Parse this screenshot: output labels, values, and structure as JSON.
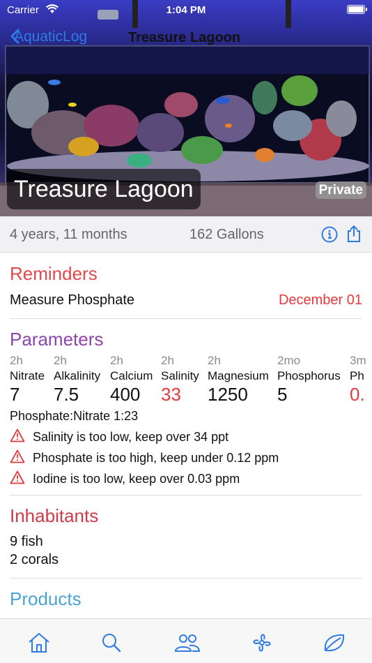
{
  "status": {
    "carrier": "Carrier",
    "time": "1:04 PM"
  },
  "nav": {
    "back_label": "AquaticLog",
    "title": "Treasure Lagoon"
  },
  "hero": {
    "tank_name": "Treasure Lagoon",
    "privacy_badge": "Private"
  },
  "info": {
    "age": "4 years, 11 months",
    "volume": "162 Gallons"
  },
  "reminders": {
    "title": "Reminders",
    "items": [
      {
        "label": "Measure Phosphate",
        "date": "December 01"
      }
    ]
  },
  "parameters": {
    "title": "Parameters",
    "items": [
      {
        "ago": "2h",
        "name": "Nitrate",
        "value": "7"
      },
      {
        "ago": "2h",
        "name": "Alkalinity",
        "value": "7.5"
      },
      {
        "ago": "2h",
        "name": "Calcium",
        "value": "400"
      },
      {
        "ago": "2h",
        "name": "Salinity",
        "value": "33"
      },
      {
        "ago": "2h",
        "name": "Magnesium",
        "value": "1250"
      },
      {
        "ago": "2mo",
        "name": "Phosphorus",
        "value": "5"
      },
      {
        "ago": "3m",
        "name": "Ph",
        "value": "0."
      }
    ],
    "ratio": "Phosphate:Nitrate 1:23",
    "warnings": [
      "Salinity is too low, keep over 34 ppt",
      "Phosphate is too high, keep under 0.12 ppm",
      "Iodine is too low, keep over 0.03 ppm"
    ]
  },
  "inhabitants": {
    "title": "Inhabitants",
    "fish": "9 fish",
    "corals": "2 corals"
  },
  "products": {
    "title": "Products"
  },
  "colors": {
    "accent_blue": "#2d7be5",
    "reminders_red": "#e5474b",
    "parameters_purple": "#8e44ad",
    "inhabitants_red": "#d03a4a",
    "products_blue": "#4aa3d8",
    "warning_red": "#e5393c"
  },
  "tabbar": {
    "icons": [
      "home-icon",
      "search-icon",
      "community-icon",
      "fan-icon",
      "leaf-icon"
    ]
  }
}
